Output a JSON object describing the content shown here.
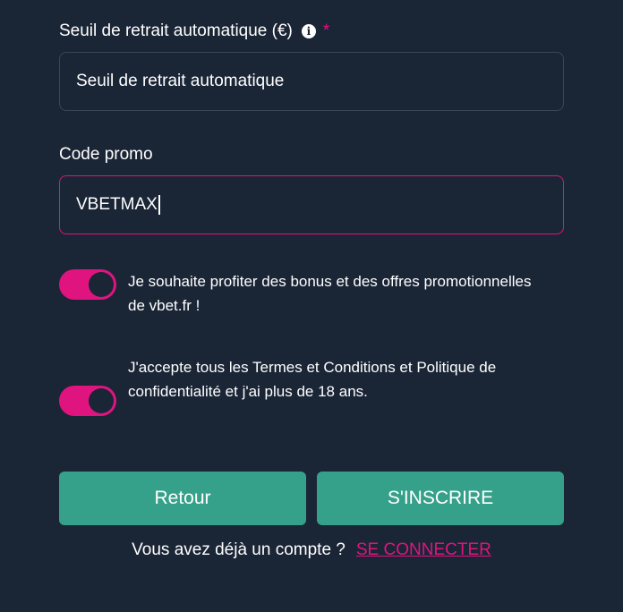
{
  "withdrawal": {
    "label": "Seuil de retrait automatique (€)",
    "required_mark": "*",
    "info_icon": "info-icon",
    "input_value": "Seuil de retrait automatique"
  },
  "promo": {
    "label": "Code promo",
    "input_value": "VBETMAX"
  },
  "toggles": [
    {
      "text_line1": "Je souhaite profiter des bonus et des offres promotionnelles",
      "text_line2": "de vbet.fr !",
      "state": "on"
    },
    {
      "text_line1": "J'accepte tous les Termes et Conditions et Politique de",
      "text_line2": "confidentialité et j'ai plus de 18 ans.",
      "state": "on"
    }
  ],
  "buttons": {
    "back": "Retour",
    "register": "S'INSCRIRE"
  },
  "footer": {
    "question": "Vous avez déjà un compte ?",
    "login_link": "SE CONNECTER"
  },
  "colors": {
    "background": "#1a2536",
    "accent": "#e0147f",
    "button": "#36a18a",
    "input_border": "#3b4556"
  }
}
